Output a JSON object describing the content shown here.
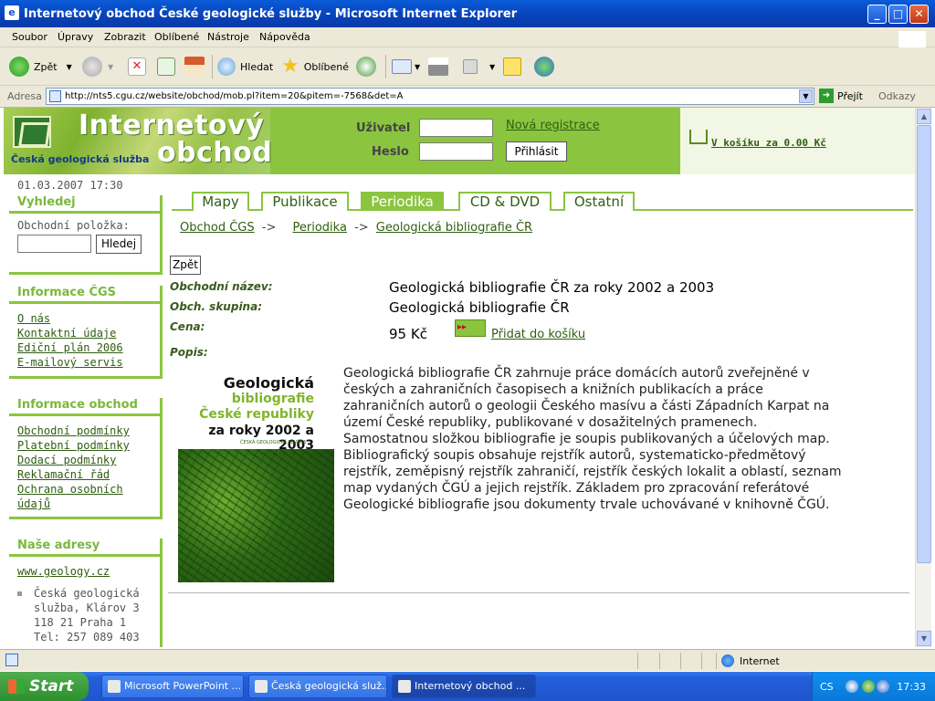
{
  "window": {
    "title": "Internetový obchod České geologické služby - Microsoft Internet Explorer",
    "controls": {
      "minimize": "_",
      "maximize": "□",
      "close": "✕"
    }
  },
  "menubar": [
    "Soubor",
    "Úpravy",
    "Zobrazit",
    "Oblíbené",
    "Nástroje",
    "Nápověda"
  ],
  "toolbar": {
    "back": "Zpět",
    "search": "Hledat",
    "favorites": "Oblíbené"
  },
  "address": {
    "label": "Adresa",
    "url": "http://nts5.cgu.cz/website/obchod/mob.pl?item=20&pitem=-7568&det=A",
    "go": "Přejít",
    "links": "Odkazy"
  },
  "header": {
    "title_line1": "Internetový",
    "title_line2": "obchod",
    "subtitle": "Česká geologická služba",
    "user_label": "Uživatel",
    "password_label": "Heslo",
    "register_link": "Nová registrace",
    "login_button": "Přihlásit",
    "cart_link": "V košíku za 0.00 Kč"
  },
  "sidebar": {
    "datetime": "01.03.2007 17:30",
    "search": {
      "heading": "Vyhledej",
      "label": "Obchodní položka:",
      "value": "",
      "button": "Hledej"
    },
    "info_cgs": {
      "heading": "Informace ČGS",
      "links": [
        "O nás",
        "Kontaktní údaje",
        "Ediční plán 2006",
        "E-mailový servis"
      ]
    },
    "info_shop": {
      "heading": "Informace obchod",
      "links": [
        "Obchodní podmínky",
        "Platební podmínky",
        "Dodací podmínky",
        "Reklamační řád",
        "Ochrana osobních údajů"
      ]
    },
    "addresses": {
      "heading": "Naše adresy",
      "link": "www.geology.cz",
      "address_lines": [
        "Česká geologická",
        "služba, Klárov 3",
        "118 21 Praha 1",
        "Tel: 257 089 403"
      ]
    }
  },
  "tabs": [
    {
      "label": "Mapy",
      "active": false
    },
    {
      "label": "Publikace",
      "active": false
    },
    {
      "label": "Periodika",
      "active": true
    },
    {
      "label": "CD & DVD",
      "active": false
    },
    {
      "label": "Ostatní",
      "active": false
    }
  ],
  "breadcrumb": {
    "items": [
      "Obchod ČGS",
      "Periodika",
      "Geologická bibliografie ČR"
    ],
    "separator": "->"
  },
  "product": {
    "back_button": "Zpět",
    "name_label": "Obchodní název:",
    "name": "Geologická bibliografie ČR za roky 2002 a 2003",
    "group_label": "Obch. skupina:",
    "group": "Geologická bibliografie ČR",
    "price_label": "Cena:",
    "price": "95 Kč",
    "add_to_cart": "Přidat do košíku",
    "description_label": "Popis:",
    "cover": {
      "line1": "Geologická",
      "line2": "bibliografie",
      "line3": "České republiky",
      "line4": "za roky 2002 a 2003",
      "publisher": "ČESKÁ GEOLOGICKÁ SLUŽBA"
    },
    "description": "Geologická bibliografie ČR zahrnuje práce domácích autorů zveřejněné v českých a zahraničních časopisech a knižních publikacích a práce zahraničních autorů o geologii Českého masívu a části Západních Karpat na území České republiky, publikované v dosažitelných pramenech. Samostatnou složkou bibliografie je soupis publikovaných a účelových map. Bibliografický soupis obsahuje rejstřík autorů, systematicko-předmětový rejstřík, zeměpisný rejstřík zahraničí, rejstřík českých lokalit a oblastí, seznam map vydaných ČGÚ a jejich rejstřík. Základem pro zpracování referátové Geologické bibliografie jsou dokumenty trvale uchovávané v knihovně ČGÚ."
  },
  "statusbar": {
    "zone": "Internet"
  },
  "taskbar": {
    "start": "Start",
    "tasks": [
      "Microsoft PowerPoint ...",
      "Česká geologická služ...",
      "Internetový obchod ..."
    ],
    "active_task": 2,
    "lang": "CS",
    "clock": "17:33"
  },
  "colors": {
    "accent_green": "#8bc53f",
    "link_green": "#2f5e11",
    "title_blue": "#0a5bd8"
  }
}
